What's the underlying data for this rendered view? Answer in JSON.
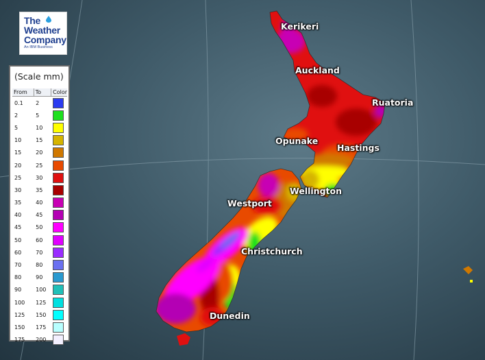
{
  "logo": {
    "line1": "The",
    "line2": "Weather",
    "line3": "Company",
    "tagline": "An IBM Business"
  },
  "legend": {
    "title": "(Scale mm)",
    "headers": {
      "from": "From",
      "to": "To",
      "color": "Color"
    },
    "rows": [
      {
        "from": "0.1",
        "to": "2",
        "color": "#2b3bf0"
      },
      {
        "from": "2",
        "to": "5",
        "color": "#1ee01e"
      },
      {
        "from": "5",
        "to": "10",
        "color": "#ffff00"
      },
      {
        "from": "10",
        "to": "15",
        "color": "#d6b400"
      },
      {
        "from": "15",
        "to": "20",
        "color": "#d07800"
      },
      {
        "from": "20",
        "to": "25",
        "color": "#e84a00"
      },
      {
        "from": "25",
        "to": "30",
        "color": "#e01010"
      },
      {
        "from": "30",
        "to": "35",
        "color": "#a80000"
      },
      {
        "from": "35",
        "to": "40",
        "color": "#c800b4"
      },
      {
        "from": "40",
        "to": "45",
        "color": "#b400b4"
      },
      {
        "from": "45",
        "to": "50",
        "color": "#ff00ff"
      },
      {
        "from": "50",
        "to": "60",
        "color": "#e000ff"
      },
      {
        "from": "60",
        "to": "70",
        "color": "#9a2cff"
      },
      {
        "from": "70",
        "to": "80",
        "color": "#6a70f0"
      },
      {
        "from": "80",
        "to": "90",
        "color": "#2a9ad0"
      },
      {
        "from": "90",
        "to": "100",
        "color": "#20c0b8"
      },
      {
        "from": "100",
        "to": "125",
        "color": "#00e0e0"
      },
      {
        "from": "125",
        "to": "150",
        "color": "#00ffff"
      },
      {
        "from": "150",
        "to": "175",
        "color": "#b8ffff"
      },
      {
        "from": "175",
        "to": "200",
        "color": "#f4f0ff"
      }
    ]
  },
  "cities": {
    "kerikeri": "Kerikeri",
    "auckland": "Auckland",
    "ruatoria": "Ruatoria",
    "opunake": "Opunake",
    "hastings": "Hastings",
    "wellington": "Wellington",
    "westport": "Westport",
    "christchurch": "Christchurch",
    "dunedin": "Dunedin"
  }
}
